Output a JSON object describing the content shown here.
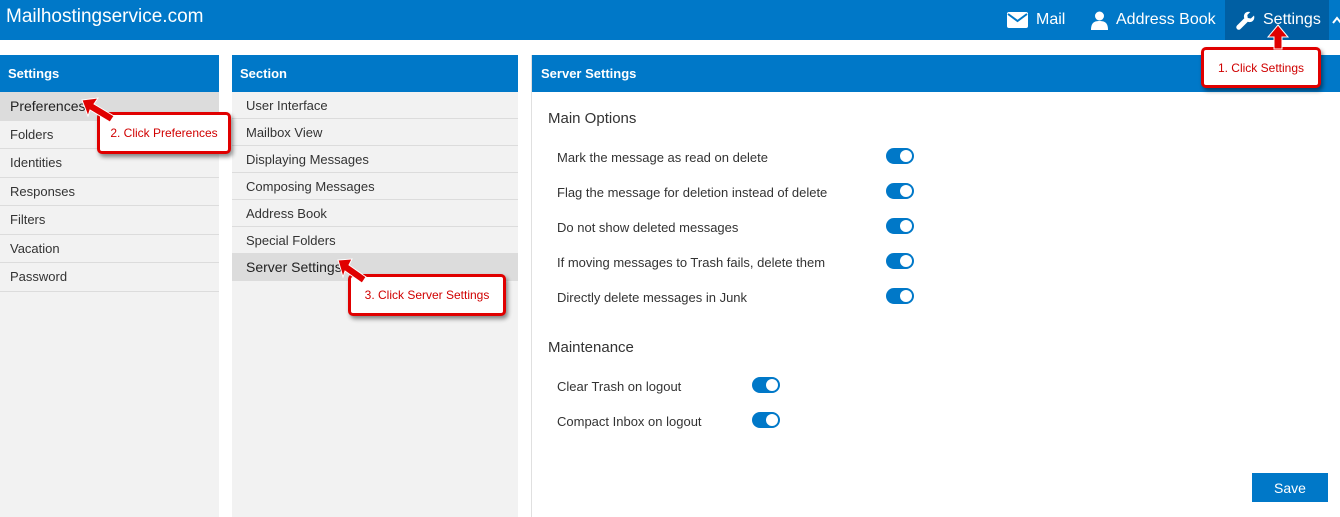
{
  "app": {
    "title": "Mailhostingservice.com"
  },
  "nav": {
    "mail": "Mail",
    "address_book": "Address Book",
    "settings": "Settings",
    "icons": {
      "mail": "envelope-icon",
      "address_book": "person-icon",
      "settings": "wrench-icon"
    }
  },
  "settings_panel": {
    "title": "Settings",
    "items": [
      {
        "label": "Preferences",
        "active": true
      },
      {
        "label": "Folders"
      },
      {
        "label": "Identities"
      },
      {
        "label": "Responses"
      },
      {
        "label": "Filters"
      },
      {
        "label": "Vacation"
      },
      {
        "label": "Password"
      }
    ]
  },
  "section_panel": {
    "title": "Section",
    "items": [
      {
        "label": "User Interface"
      },
      {
        "label": "Mailbox View"
      },
      {
        "label": "Displaying Messages"
      },
      {
        "label": "Composing Messages"
      },
      {
        "label": "Address Book"
      },
      {
        "label": "Special Folders"
      },
      {
        "label": "Server Settings",
        "active": true
      }
    ]
  },
  "main": {
    "title": "Server Settings",
    "main_options": {
      "title": "Main Options",
      "options": [
        {
          "label": "Mark the message as read on delete",
          "enabled": true
        },
        {
          "label": "Flag the message for deletion instead of delete",
          "enabled": true
        },
        {
          "label": "Do not show deleted messages",
          "enabled": true
        },
        {
          "label": "If moving messages to Trash fails, delete them",
          "enabled": true
        },
        {
          "label": "Directly delete messages in Junk",
          "enabled": true
        }
      ]
    },
    "maintenance": {
      "title": "Maintenance",
      "options": [
        {
          "label": "Clear Trash on logout",
          "enabled": true
        },
        {
          "label": "Compact Inbox on logout",
          "enabled": true
        }
      ]
    },
    "save_label": "Save"
  },
  "callouts": {
    "step1": "1. Click Settings",
    "step2": "2. Click Preferences",
    "step3": "3. Click Server Settings"
  },
  "colors": {
    "accent": "#0078c8",
    "active_nav": "#005fa3",
    "callout": "#e00000"
  }
}
